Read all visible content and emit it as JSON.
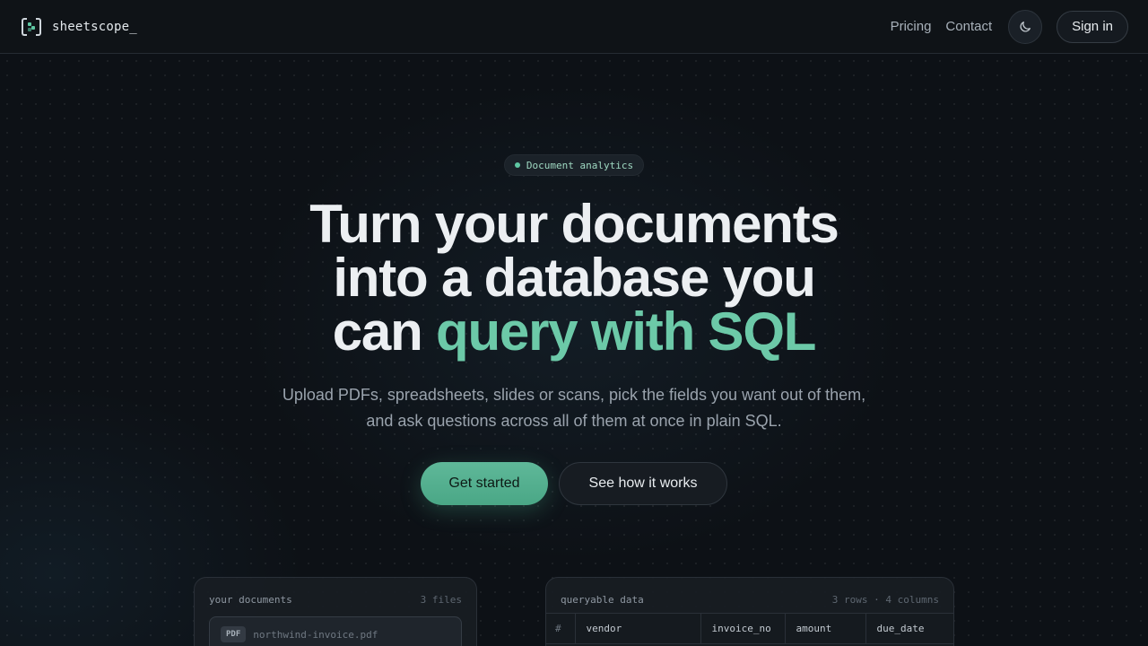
{
  "nav": {
    "brand": "sheetscope_",
    "links": [
      "Pricing",
      "Contact"
    ],
    "theme_icon": "moon-icon",
    "sign_in": "Sign in"
  },
  "hero": {
    "badge": "Document analytics",
    "headline_line1": "Turn your documents",
    "headline_line2": "into a database you",
    "headline_line3_plain": "can ",
    "headline_line3_accent": "query with SQL",
    "subtitle": "Upload PDFs, spreadsheets, slides or scans, pick the fields you want out of them, and ask questions across all of them at once in plain SQL.",
    "primary_cta": "Get started",
    "secondary_cta": "See how it works"
  },
  "documents_panel": {
    "title": "your documents",
    "count": "3 files",
    "files": [
      {
        "type": "PDF",
        "name": "northwind-invoice.pdf"
      }
    ]
  },
  "data_panel": {
    "title": "queryable data",
    "meta": "3 rows · 4 columns",
    "columns": [
      "#",
      "vendor",
      "invoice_no",
      "amount",
      "due_date"
    ]
  },
  "colors": {
    "accent": "#6cc9a8",
    "background": "#0d1116",
    "primary_button": "#55b291"
  }
}
